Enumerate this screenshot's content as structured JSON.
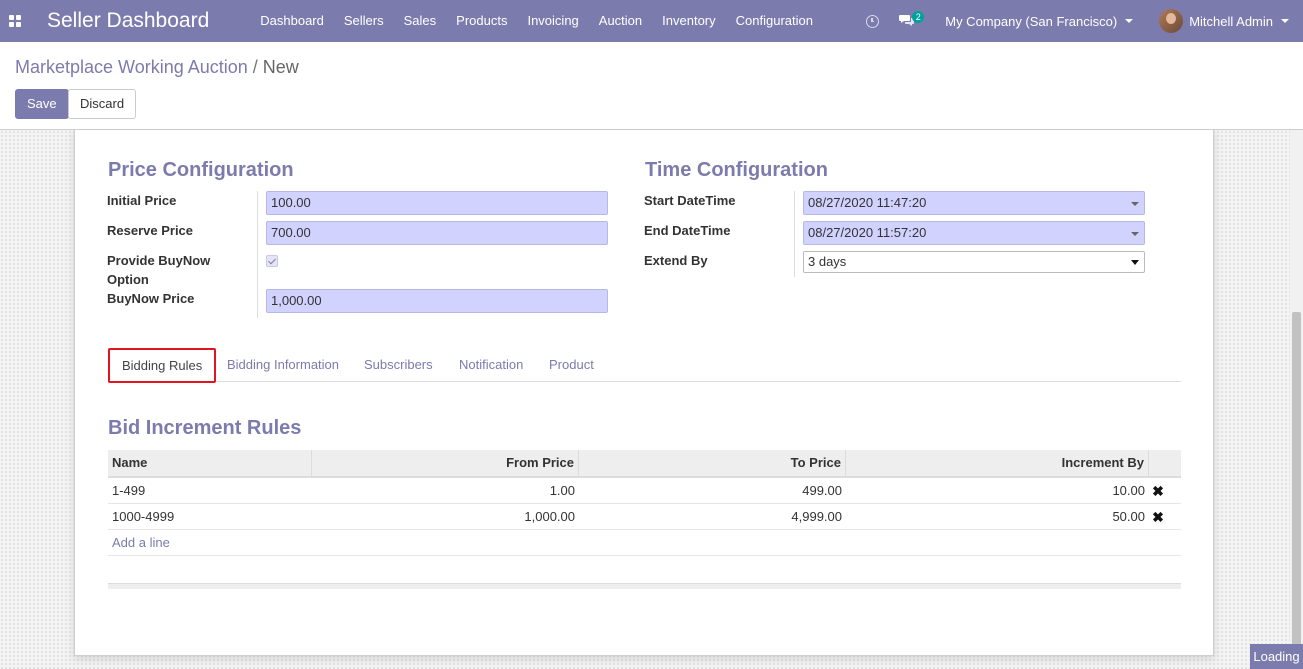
{
  "navbar": {
    "brand": "Seller Dashboard",
    "menu": [
      "Dashboard",
      "Sellers",
      "Sales",
      "Products",
      "Invoicing",
      "Auction",
      "Inventory",
      "Configuration"
    ],
    "chat_count": "2",
    "company": "My Company (San Francisco)",
    "user": "Mitchell Admin"
  },
  "breadcrumb": {
    "parent": "Marketplace Working Auction",
    "separator": "/",
    "current": "New"
  },
  "buttons": {
    "save": "Save",
    "discard": "Discard"
  },
  "price_config": {
    "title": "Price Configuration",
    "initial_price_label": "Initial Price",
    "initial_price": "100.00",
    "reserve_price_label": "Reserve Price",
    "reserve_price": "700.00",
    "buynow_option_label_1": "Provide BuyNow",
    "buynow_option_label_2": "Option",
    "buynow_option_checked": true,
    "buynow_price_label": "BuyNow Price",
    "buynow_price": "1,000.00"
  },
  "time_config": {
    "title": "Time Configuration",
    "start_label": "Start DateTime",
    "start_value": "08/27/2020 11:47:20",
    "end_label": "End DateTime",
    "end_value": "08/27/2020 11:57:20",
    "extend_label": "Extend By",
    "extend_value": "3 days"
  },
  "tabs": [
    {
      "label": "Bidding Rules",
      "active": true
    },
    {
      "label": "Bidding Information",
      "active": false
    },
    {
      "label": "Subscribers",
      "active": false
    },
    {
      "label": "Notification",
      "active": false
    },
    {
      "label": "Product",
      "active": false
    }
  ],
  "bid_rules": {
    "title": "Bid Increment Rules",
    "columns": [
      "Name",
      "From Price",
      "To Price",
      "Increment By"
    ],
    "rows": [
      {
        "name": "1-499",
        "from": "1.00",
        "to": "499.00",
        "increment": "10.00"
      },
      {
        "name": "1000-4999",
        "from": "1,000.00",
        "to": "4,999.00",
        "increment": "50.00"
      }
    ],
    "add_line": "Add a line"
  },
  "status": {
    "loading": "Loading"
  },
  "colors": {
    "primary": "#7c7bad",
    "field_bg": "#d2d2ff",
    "highlight_border": "#e1151f",
    "badge": "#00a09d"
  }
}
